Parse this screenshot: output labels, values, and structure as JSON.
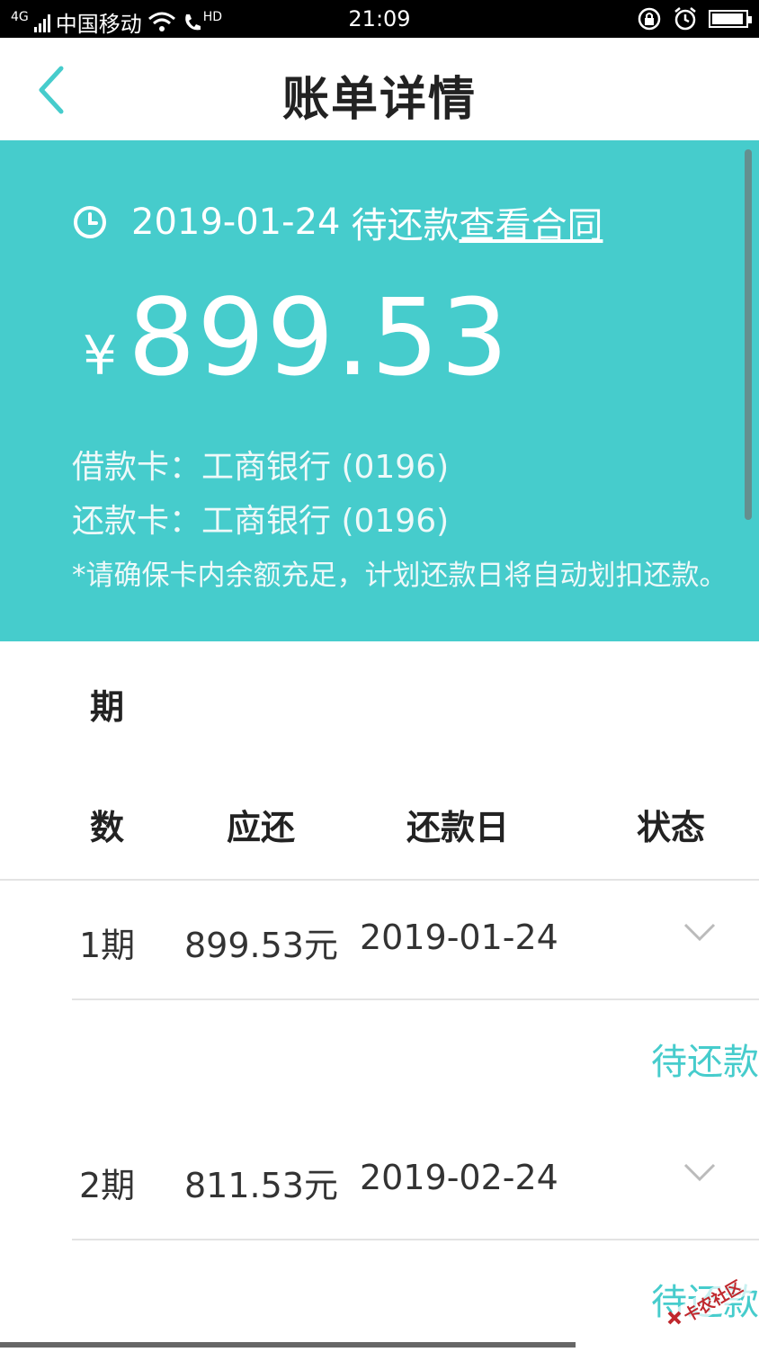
{
  "status_bar": {
    "network": "4G",
    "carrier": "中国移动",
    "hd": "HD",
    "time": "21:09"
  },
  "header": {
    "title": "账单详情"
  },
  "bill": {
    "due_date": "2019-01-24",
    "due_status": "待还款",
    "contract_link": "查看合同",
    "currency": "¥",
    "amount": "899.53",
    "loan_card": "借款卡：工商银行 (0196)",
    "repay_card": "还款卡：工商银行 (0196)",
    "note": "*请确保卡内余额充足，计划还款日将自动划扣还款。"
  },
  "table": {
    "col_period_1": "期",
    "col_period_2": "数",
    "col_due": "应还",
    "col_date": "还款日",
    "col_status": "状态",
    "rows": [
      {
        "period": "1期",
        "amount": "899.53元",
        "date": "2019-01-24",
        "status": "待还款"
      },
      {
        "period": "2期",
        "amount": "811.53元",
        "date": "2019-02-24",
        "status": "待还款"
      }
    ]
  },
  "watermark": "卡农社区",
  "colors": {
    "accent": "#46cccc"
  },
  "icons": [
    "back-arrow-icon",
    "clock-icon",
    "chevron-down-icon"
  ]
}
